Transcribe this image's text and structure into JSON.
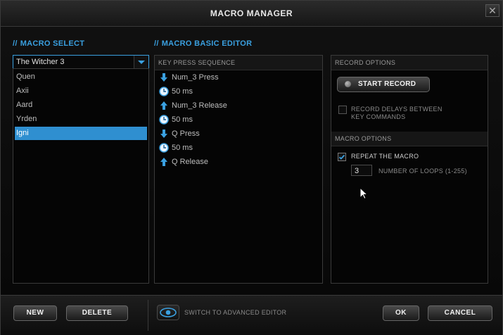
{
  "window": {
    "title": "MACRO MANAGER",
    "close_glyph": "✕"
  },
  "macro_select": {
    "heading_slash": "//",
    "heading": "MACRO SELECT",
    "dropdown_value": "The Witcher 3",
    "items": [
      {
        "label": "Quen"
      },
      {
        "label": "Axii"
      },
      {
        "label": "Aard"
      },
      {
        "label": "Yrden"
      },
      {
        "label": "Igni"
      }
    ],
    "selected_index": 4
  },
  "basic_editor": {
    "heading_slash": "//",
    "heading": "MACRO BASIC EDITOR",
    "sequence_header": "KEY PRESS SEQUENCE",
    "sequence": [
      {
        "icon": "arrow-down-icon",
        "text": "Num_3 Press"
      },
      {
        "icon": "clock-icon",
        "text": "50 ms"
      },
      {
        "icon": "arrow-up-icon",
        "text": "Num_3 Release"
      },
      {
        "icon": "clock-icon",
        "text": "50 ms"
      },
      {
        "icon": "arrow-down-icon",
        "text": "Q Press"
      },
      {
        "icon": "clock-icon",
        "text": "50 ms"
      },
      {
        "icon": "arrow-up-icon",
        "text": "Q Release"
      }
    ]
  },
  "record_options": {
    "header": "RECORD OPTIONS",
    "start_record_label": "START RECORD",
    "record_delays_line1": "RECORD DELAYS BETWEEN",
    "record_delays_line2": "KEY COMMANDS",
    "record_delays_checked": false
  },
  "macro_options": {
    "header": "MACRO OPTIONS",
    "repeat_label": "REPEAT THE MACRO",
    "repeat_checked": true,
    "loops_value": "3",
    "loops_label": "NUMBER OF LOOPS (1-255)"
  },
  "footer": {
    "new_label": "NEW",
    "delete_label": "DELETE",
    "switch_label": "SWITCH TO ADVANCED EDITOR",
    "ok_label": "OK",
    "cancel_label": "CANCEL"
  },
  "colors": {
    "accent": "#3aa0e0",
    "selected": "#2f8fd0"
  }
}
